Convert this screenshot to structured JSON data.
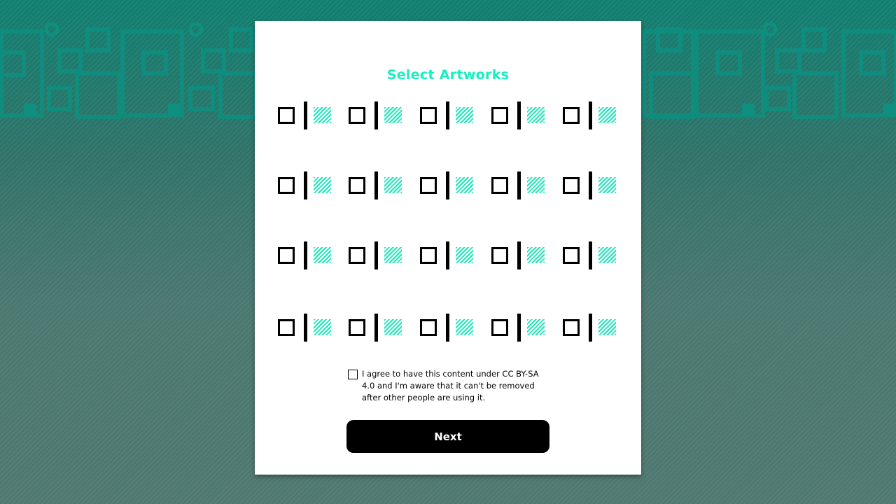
{
  "title": "Select Artworks",
  "artworks_rows": 4,
  "artworks_cols": 5,
  "consent": {
    "checked": false,
    "text": "I agree to have this content under CC BY-SA 4.0 and I'm aware that it can't be removed after other people are using it."
  },
  "next_label": "Next",
  "colors": {
    "accent": "#14f0c0",
    "tile_hatch": "#1ee6b8",
    "button_bg": "#000000"
  }
}
